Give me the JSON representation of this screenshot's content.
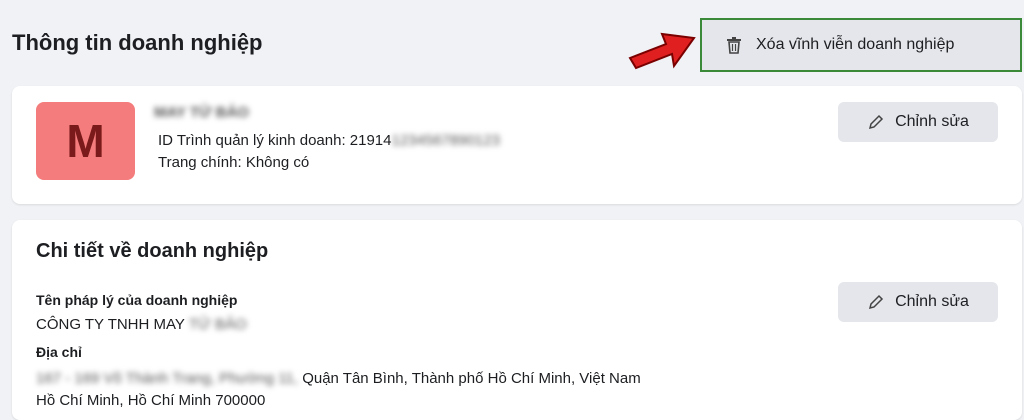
{
  "header": {
    "title": "Thông tin doanh nghiệp",
    "delete_label": "Xóa vĩnh viễn doanh nghiệp"
  },
  "profile": {
    "avatar_letter": "M",
    "name_blurred": "MAY TỬ BẢO",
    "id_label": "ID Trình quản lý kinh doanh: 21914",
    "id_blurred": "1234567890123",
    "main_page": "Trang chính: Không có",
    "edit_label": "Chỉnh sửa"
  },
  "details": {
    "title": "Chi tiết về doanh nghiệp",
    "legal_name_label": "Tên pháp lý của doanh nghiệp",
    "legal_name_value": "CÔNG TY TNHH MAY",
    "legal_name_blurred": "TỬ BẢO",
    "address_label": "Địa chỉ",
    "address_blurred": "167 - 169 Võ Thành Trang, Phường 11,",
    "address_line1": "Quận Tân Bình, Thành phố Hồ Chí Minh, Việt Nam",
    "address_line2": "Hồ Chí Minh, Hồ Chí Minh 700000",
    "edit_label": "Chỉnh sửa"
  },
  "colors": {
    "avatar_bg": "#f47c7c",
    "arrow": "#e02020",
    "highlight_border": "#3a8a3a"
  }
}
